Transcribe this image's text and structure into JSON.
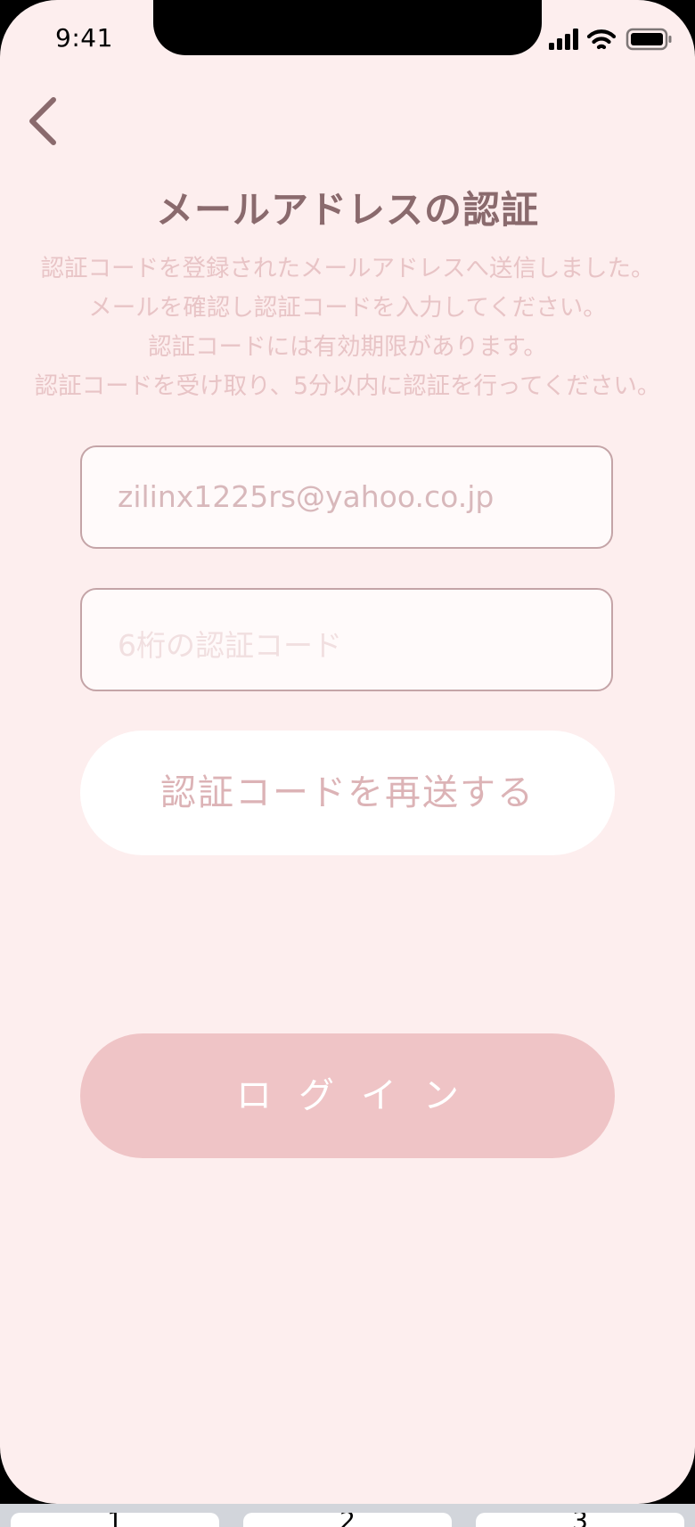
{
  "status_bar": {
    "time": "9:41",
    "icons": [
      "cellular-signal-icon",
      "wifi-icon",
      "battery-icon"
    ]
  },
  "nav": {
    "back_icon": "chevron-left-icon"
  },
  "title": "メールアドレスの認証",
  "description": [
    "認証コードを登録されたメールアドレスへ送信しました。",
    "メールを確認し認証コードを入力してください。",
    "認証コードには有効期限があります。",
    "認証コードを受け取り、5分以内に認証を行ってください。"
  ],
  "form": {
    "email_value": "zilinx1225rs@yahoo.co.jp",
    "code_placeholder": "6桁の認証コード"
  },
  "buttons": {
    "resend_label": "認証コードを再送する",
    "login_label": "ログイン"
  },
  "keyboard": {
    "keys": [
      "1",
      "2",
      "3"
    ]
  },
  "colors": {
    "background": "#fdeeee",
    "title": "#8a6a6d",
    "description": "#e8c4c6",
    "field_border": "#c4a4a7",
    "resend_text": "#dcb3b6",
    "login_bg": "#efc4c6"
  }
}
